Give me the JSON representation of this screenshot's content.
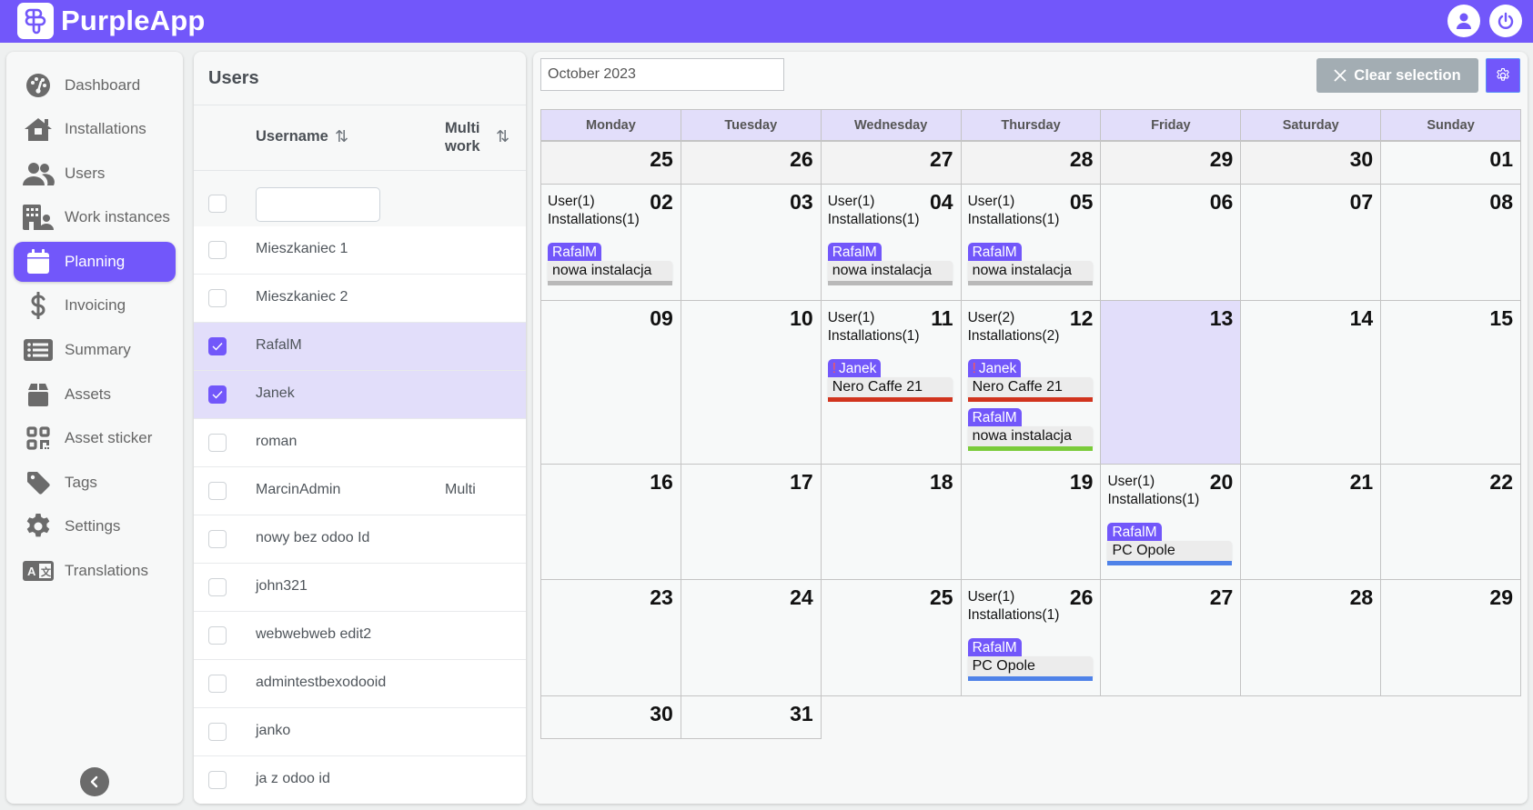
{
  "app": {
    "title": "PurpleApp"
  },
  "topbar": {
    "profile_icon": "user-circle-icon",
    "power_icon": "power-icon"
  },
  "sidebar": {
    "items": [
      {
        "label": "Dashboard",
        "icon": "dashboard-gauge-icon",
        "active": false
      },
      {
        "label": "Installations",
        "icon": "house-icon",
        "active": false
      },
      {
        "label": "Users",
        "icon": "users-icon",
        "active": false
      },
      {
        "label": "Work instances",
        "icon": "building-user-icon",
        "active": false
      },
      {
        "label": "Planning",
        "icon": "calendar-icon",
        "active": true
      },
      {
        "label": "Invoicing",
        "icon": "dollar-icon",
        "active": false
      },
      {
        "label": "Summary",
        "icon": "list-icon",
        "active": false
      },
      {
        "label": "Assets",
        "icon": "box-icon",
        "active": false
      },
      {
        "label": "Asset sticker",
        "icon": "qr-code-icon",
        "active": false
      },
      {
        "label": "Tags",
        "icon": "tag-icon",
        "active": false
      },
      {
        "label": "Settings",
        "icon": "gear-icon",
        "active": false
      },
      {
        "label": "Translations",
        "icon": "language-icon",
        "active": false
      }
    ],
    "collapse_icon": "chevron-left-icon"
  },
  "users_panel": {
    "title": "Users",
    "columns": {
      "username": "Username",
      "multiwork_line1": "Multi",
      "multiwork_line2": "work"
    },
    "filter": {
      "value": "",
      "placeholder": ""
    },
    "rows": [
      {
        "username": "Mieszkaniec 1",
        "multiwork": "",
        "checked": false
      },
      {
        "username": "Mieszkaniec 2",
        "multiwork": "",
        "checked": false
      },
      {
        "username": "RafalM",
        "multiwork": "",
        "checked": true
      },
      {
        "username": "Janek",
        "multiwork": "",
        "checked": true
      },
      {
        "username": "roman",
        "multiwork": "",
        "checked": false
      },
      {
        "username": "MarcinAdmin",
        "multiwork": "Multi",
        "checked": false
      },
      {
        "username": "nowy bez odoo Id",
        "multiwork": "",
        "checked": false
      },
      {
        "username": "john321",
        "multiwork": "",
        "checked": false
      },
      {
        "username": "webwebweb edit2",
        "multiwork": "",
        "checked": false
      },
      {
        "username": "admintestbexodooid",
        "multiwork": "",
        "checked": false
      },
      {
        "username": "janko",
        "multiwork": "",
        "checked": false
      },
      {
        "username": "ja z odoo id",
        "multiwork": "",
        "checked": false
      }
    ]
  },
  "calendar": {
    "month_value": "October 2023",
    "clear_selection_label": "Clear selection",
    "weekdays": [
      "Monday",
      "Tuesday",
      "Wednesday",
      "Thursday",
      "Friday",
      "Saturday",
      "Sunday"
    ],
    "colors": {
      "accent": "#7257fa",
      "today_bg": "#e2defa",
      "bar_gray": "#b9b9b9",
      "bar_red": "#d1341e",
      "bar_green": "#7acb3a",
      "bar_blue": "#4f82e8"
    },
    "weeks": [
      [
        {
          "day": "25",
          "other": true
        },
        {
          "day": "26",
          "other": true
        },
        {
          "day": "27",
          "other": true
        },
        {
          "day": "28",
          "other": true
        },
        {
          "day": "29",
          "other": true
        },
        {
          "day": "30",
          "other": true
        },
        {
          "day": "01"
        }
      ],
      [
        {
          "day": "02",
          "users": "User(1)",
          "installations": "Installations(1)",
          "events": [
            {
              "user": "RafalM",
              "title": "nowa instalacja",
              "color": "#b9b9b9",
              "warning": false
            }
          ]
        },
        {
          "day": "03"
        },
        {
          "day": "04",
          "users": "User(1)",
          "installations": "Installations(1)",
          "events": [
            {
              "user": "RafalM",
              "title": "nowa instalacja",
              "color": "#b9b9b9",
              "warning": false
            }
          ]
        },
        {
          "day": "05",
          "users": "User(1)",
          "installations": "Installations(1)",
          "events": [
            {
              "user": "RafalM",
              "title": "nowa instalacja",
              "color": "#b9b9b9",
              "warning": false
            }
          ]
        },
        {
          "day": "06"
        },
        {
          "day": "07"
        },
        {
          "day": "08"
        }
      ],
      [
        {
          "day": "09"
        },
        {
          "day": "10"
        },
        {
          "day": "11",
          "users": "User(1)",
          "installations": "Installations(1)",
          "events": [
            {
              "user": "Janek",
              "title": "Nero Caffe 21",
              "color": "#d1341e",
              "warning": true
            }
          ]
        },
        {
          "day": "12",
          "users": "User(2)",
          "installations": "Installations(2)",
          "events": [
            {
              "user": "Janek",
              "title": "Nero Caffe 21",
              "color": "#d1341e",
              "warning": true
            },
            {
              "user": "RafalM",
              "title": "nowa instalacja",
              "color": "#7acb3a",
              "warning": false
            }
          ]
        },
        {
          "day": "13",
          "today": true
        },
        {
          "day": "14"
        },
        {
          "day": "15"
        }
      ],
      [
        {
          "day": "16"
        },
        {
          "day": "17"
        },
        {
          "day": "18"
        },
        {
          "day": "19"
        },
        {
          "day": "20",
          "users": "User(1)",
          "installations": "Installations(1)",
          "events": [
            {
              "user": "RafalM",
              "title": "PC Opole",
              "color": "#4f82e8",
              "warning": false
            }
          ]
        },
        {
          "day": "21"
        },
        {
          "day": "22"
        }
      ],
      [
        {
          "day": "23"
        },
        {
          "day": "24"
        },
        {
          "day": "25"
        },
        {
          "day": "26",
          "users": "User(1)",
          "installations": "Installations(1)",
          "events": [
            {
              "user": "RafalM",
              "title": "PC Opole",
              "color": "#4f82e8",
              "warning": false
            }
          ]
        },
        {
          "day": "27"
        },
        {
          "day": "28"
        },
        {
          "day": "29"
        }
      ],
      [
        {
          "day": "30"
        },
        {
          "day": "31"
        }
      ]
    ]
  }
}
